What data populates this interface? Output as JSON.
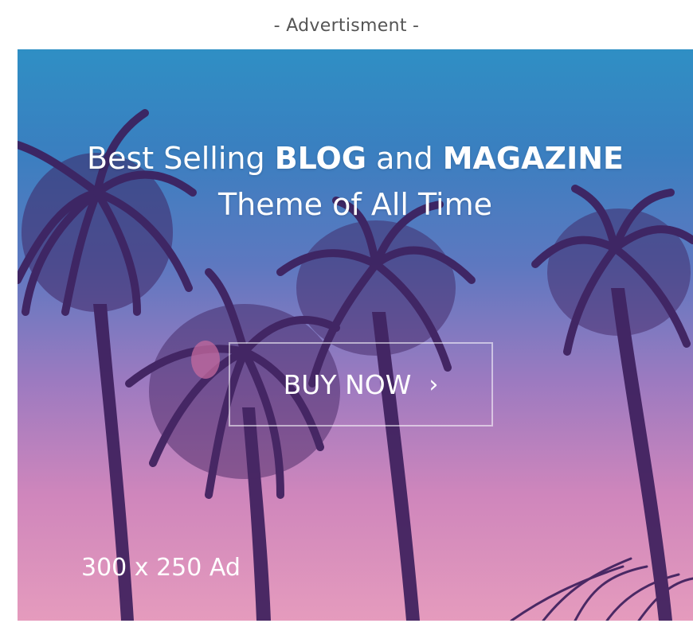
{
  "ad": {
    "label": "- Advertisment -",
    "headline": {
      "part1": "Best Selling ",
      "bold1": "BLOG",
      "part2": " and ",
      "bold2": "MAGAZINE",
      "line2": "Theme of All Time"
    },
    "cta_label": "BUY NOW",
    "cta_icon": "chevron-right-icon",
    "size_text": "300 x 250 Ad"
  },
  "colors": {
    "sky_top": "#2f8fc4",
    "sky_bottom": "#e59bbd",
    "palm": "#3d1f5c",
    "text": "#ffffff"
  }
}
